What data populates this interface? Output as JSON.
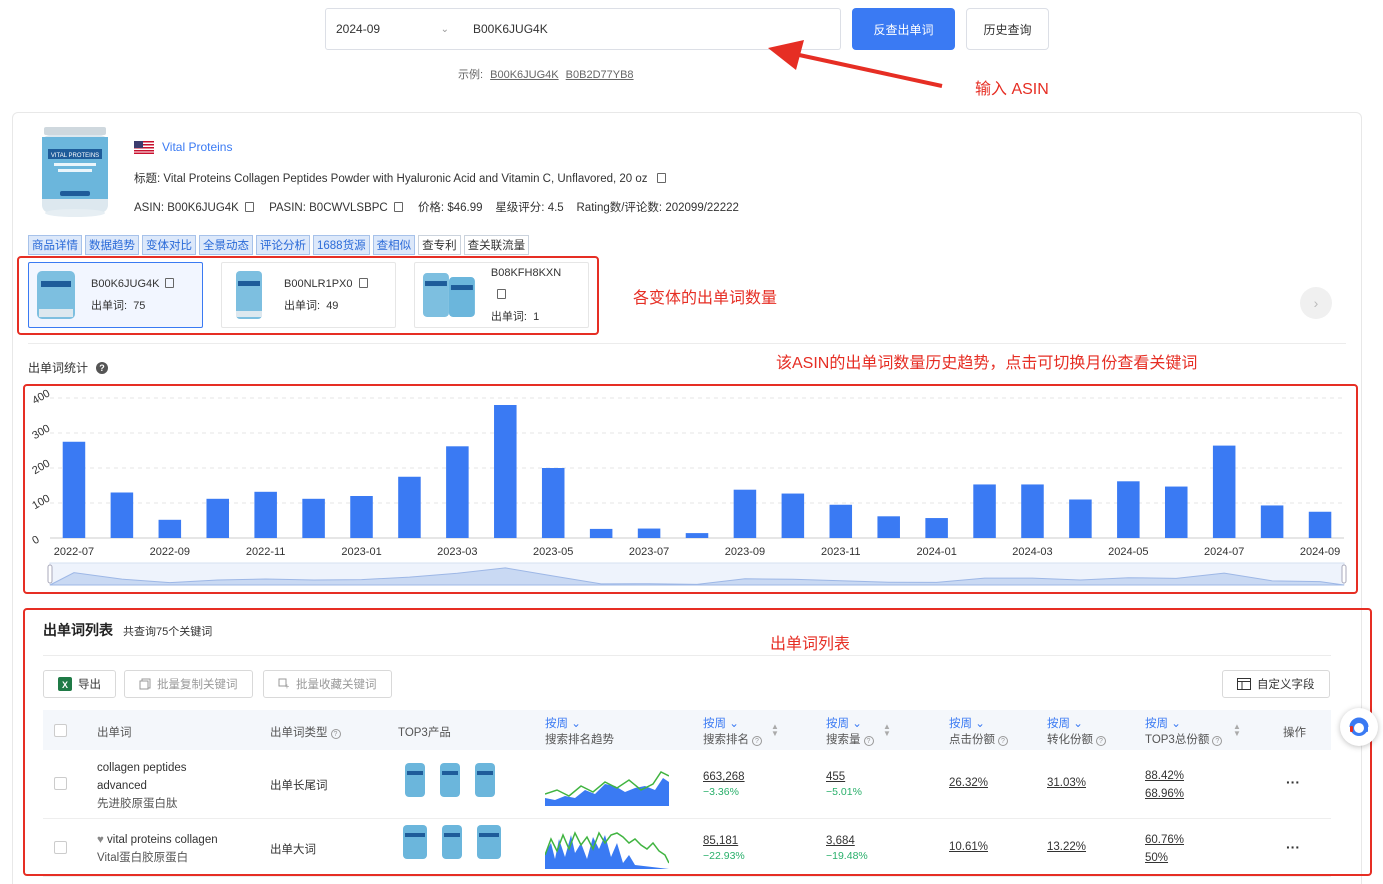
{
  "search": {
    "month": "2024-09",
    "asin_value": "B00K6JUG4K",
    "submit_label": "反查出单词",
    "history_label": "历史查询",
    "examples_prefix": "示例:",
    "example_1": "B00K6JUG4K",
    "example_2": "B0B2D77YB8"
  },
  "annotations": {
    "input_asin": "输入 ASIN",
    "variant_count": "各变体的出单词数量",
    "trend": "该ASIN的出单词数量历史趋势，点击可切换月份查看关键词",
    "list": "出单词列表"
  },
  "product": {
    "brand": "Vital Proteins",
    "title_label": "标题:",
    "title": "Vital Proteins Collagen Peptides Powder with Hyaluronic Acid and Vitamin C, Unflavored, 20 oz",
    "asin_label": "ASIN:",
    "asin": "B00K6JUG4K",
    "pasin_label": "PASIN:",
    "pasin": "B0CWVLSBPC",
    "price_label": "价格:",
    "price": "$46.99",
    "rating_label": "星级评分:",
    "rating": "4.5",
    "reviews_label": "Rating数/评论数:",
    "reviews": "202099/22222",
    "image_text": "VITAL PROTEINS"
  },
  "tags": [
    {
      "label": "商品详情",
      "style": "blue"
    },
    {
      "label": "数据趋势",
      "style": "blue"
    },
    {
      "label": "变体对比",
      "style": "blue"
    },
    {
      "label": "全景动态",
      "style": "blue"
    },
    {
      "label": "评论分析",
      "style": "blue"
    },
    {
      "label": "1688货源",
      "style": "blue"
    },
    {
      "label": "查相似",
      "style": "blue"
    },
    {
      "label": "查专利",
      "style": "plain"
    },
    {
      "label": "查关联流量",
      "style": "plain"
    }
  ],
  "variants": [
    {
      "asin": "B00K6JUG4K",
      "label": "出单词:",
      "count": "75",
      "active": true
    },
    {
      "asin": "B00NLR1PX0",
      "label": "出单词:",
      "count": "49",
      "active": false
    },
    {
      "asin": "B08KFH8KXN",
      "label": "出单词:",
      "count": "1",
      "active": false
    }
  ],
  "stats": {
    "title": "出单词统计",
    "help_icon": "question-circle-icon"
  },
  "chart_data": {
    "type": "bar",
    "x": [
      "2022-07",
      "2022-08",
      "2022-09",
      "2022-10",
      "2022-11",
      "2022-12",
      "2023-01",
      "2023-02",
      "2023-03",
      "2023-04",
      "2023-05",
      "2023-06",
      "2023-07",
      "2023-08",
      "2023-09",
      "2023-10",
      "2023-11",
      "2023-12",
      "2024-01",
      "2024-02",
      "2024-03",
      "2024-04",
      "2024-05",
      "2024-06",
      "2024-07",
      "2024-08",
      "2024-09"
    ],
    "values": [
      275,
      130,
      52,
      112,
      132,
      112,
      120,
      175,
      262,
      380,
      200,
      26,
      27,
      14,
      138,
      127,
      95,
      62,
      57,
      153,
      153,
      110,
      162,
      147,
      264,
      93,
      75
    ],
    "tick_labels": [
      "2022-07",
      "2022-09",
      "2022-11",
      "2023-01",
      "2023-03",
      "2023-05",
      "2023-07",
      "2023-09",
      "2023-11",
      "2024-01",
      "2024-03",
      "2024-05",
      "2024-07",
      "2024-09"
    ],
    "y_ticks": [
      "0",
      "100",
      "200",
      "300",
      "400"
    ],
    "ylim": [
      0,
      400
    ],
    "grid": true,
    "color": "#3a7af3"
  },
  "list": {
    "title": "出单词列表",
    "count_text": "共查询75个关键词",
    "export_label": "导出",
    "batch_copy_label": "批量复制关键词",
    "batch_fav_label": "批量收藏关键词",
    "custom_label": "自定义字段",
    "headers": {
      "keyword": "出单词",
      "type": "出单词类型",
      "top3": "TOP3产品",
      "week": "按周",
      "trend": "搜索排名趋势",
      "rank": "搜索排名",
      "volume": "搜索量",
      "click": "点击份额",
      "conversion": "转化份额",
      "top3_share": "TOP3总份额",
      "action": "操作"
    },
    "rows": [
      {
        "keyword": "collagen peptides advanced",
        "keyword_cn": "先进胶原蛋白肽",
        "type": "出单长尾词",
        "rank": "663,268",
        "rank_change": "−3.36%",
        "volume": "455",
        "volume_change": "−5.01%",
        "click": "26.32%",
        "conversion": "31.03%",
        "top3_a": "88.42%",
        "top3_b": "68.96%",
        "more": "···"
      },
      {
        "keyword": "vital proteins collagen",
        "keyword_cn": "Vital蛋白胶原蛋白",
        "type": "出单大词",
        "rank": "85,181",
        "rank_change": "−22.93%",
        "volume": "3,684",
        "volume_change": "−19.48%",
        "click": "10.61%",
        "conversion": "13.22%",
        "top3_a": "60.76%",
        "top3_b": "50%",
        "more": "···"
      }
    ]
  }
}
